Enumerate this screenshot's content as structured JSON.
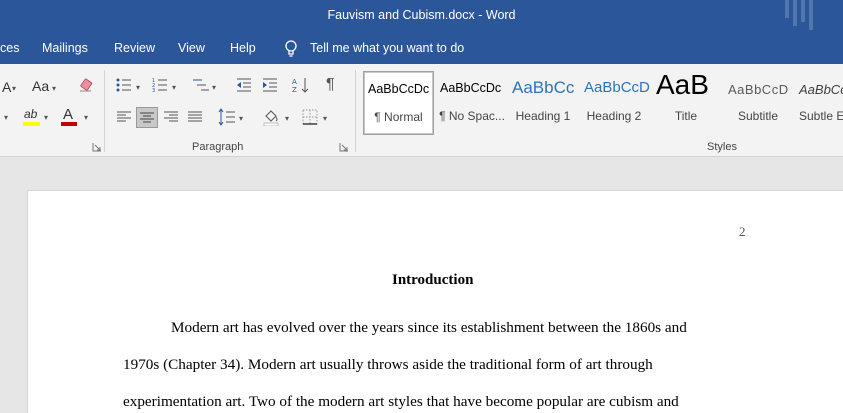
{
  "window": {
    "title": "Fauvism and Cubism.docx  -  Word"
  },
  "tabs": [
    {
      "label": "ces"
    },
    {
      "label": "Mailings"
    },
    {
      "label": "Review"
    },
    {
      "label": "View"
    },
    {
      "label": "Help"
    }
  ],
  "tellme": {
    "label": "Tell me what you want to do"
  },
  "ribbon": {
    "font_group": {
      "change_case": "Aa",
      "highlight": "ab",
      "font_color": "A",
      "grow_font": "A"
    },
    "paragraph_group": {
      "label": "Paragraph"
    },
    "styles_group": {
      "label": "Styles"
    },
    "styles": [
      {
        "preview": "AaBbCcDc",
        "name": "¶ Normal"
      },
      {
        "preview": "AaBbCcDc",
        "name": "¶ No Spac..."
      },
      {
        "preview": "AaBbCc",
        "name": "Heading 1"
      },
      {
        "preview": "AaBbCcD",
        "name": "Heading 2"
      },
      {
        "preview": "AaB",
        "name": "Title"
      },
      {
        "preview": "AaBbCcD",
        "name": "Subtitle"
      },
      {
        "preview": "AaBbCc",
        "name": "Subtle Em"
      }
    ]
  },
  "document": {
    "page_number": "2",
    "heading": "Introduction",
    "lines": [
      "Modern art has evolved over the years since its establishment between the 1860s and",
      "1970s (Chapter 34). Modern art usually throws aside the traditional form of art through",
      "experimentation art. Two of the modern art styles that have become popular are cubism and"
    ]
  },
  "colors": {
    "title_bar": "#2b579a",
    "ribbon": "#f3f3f3",
    "heading1": "#2e74b5",
    "highlight": "#ffff00",
    "font_color": "#c00000"
  }
}
